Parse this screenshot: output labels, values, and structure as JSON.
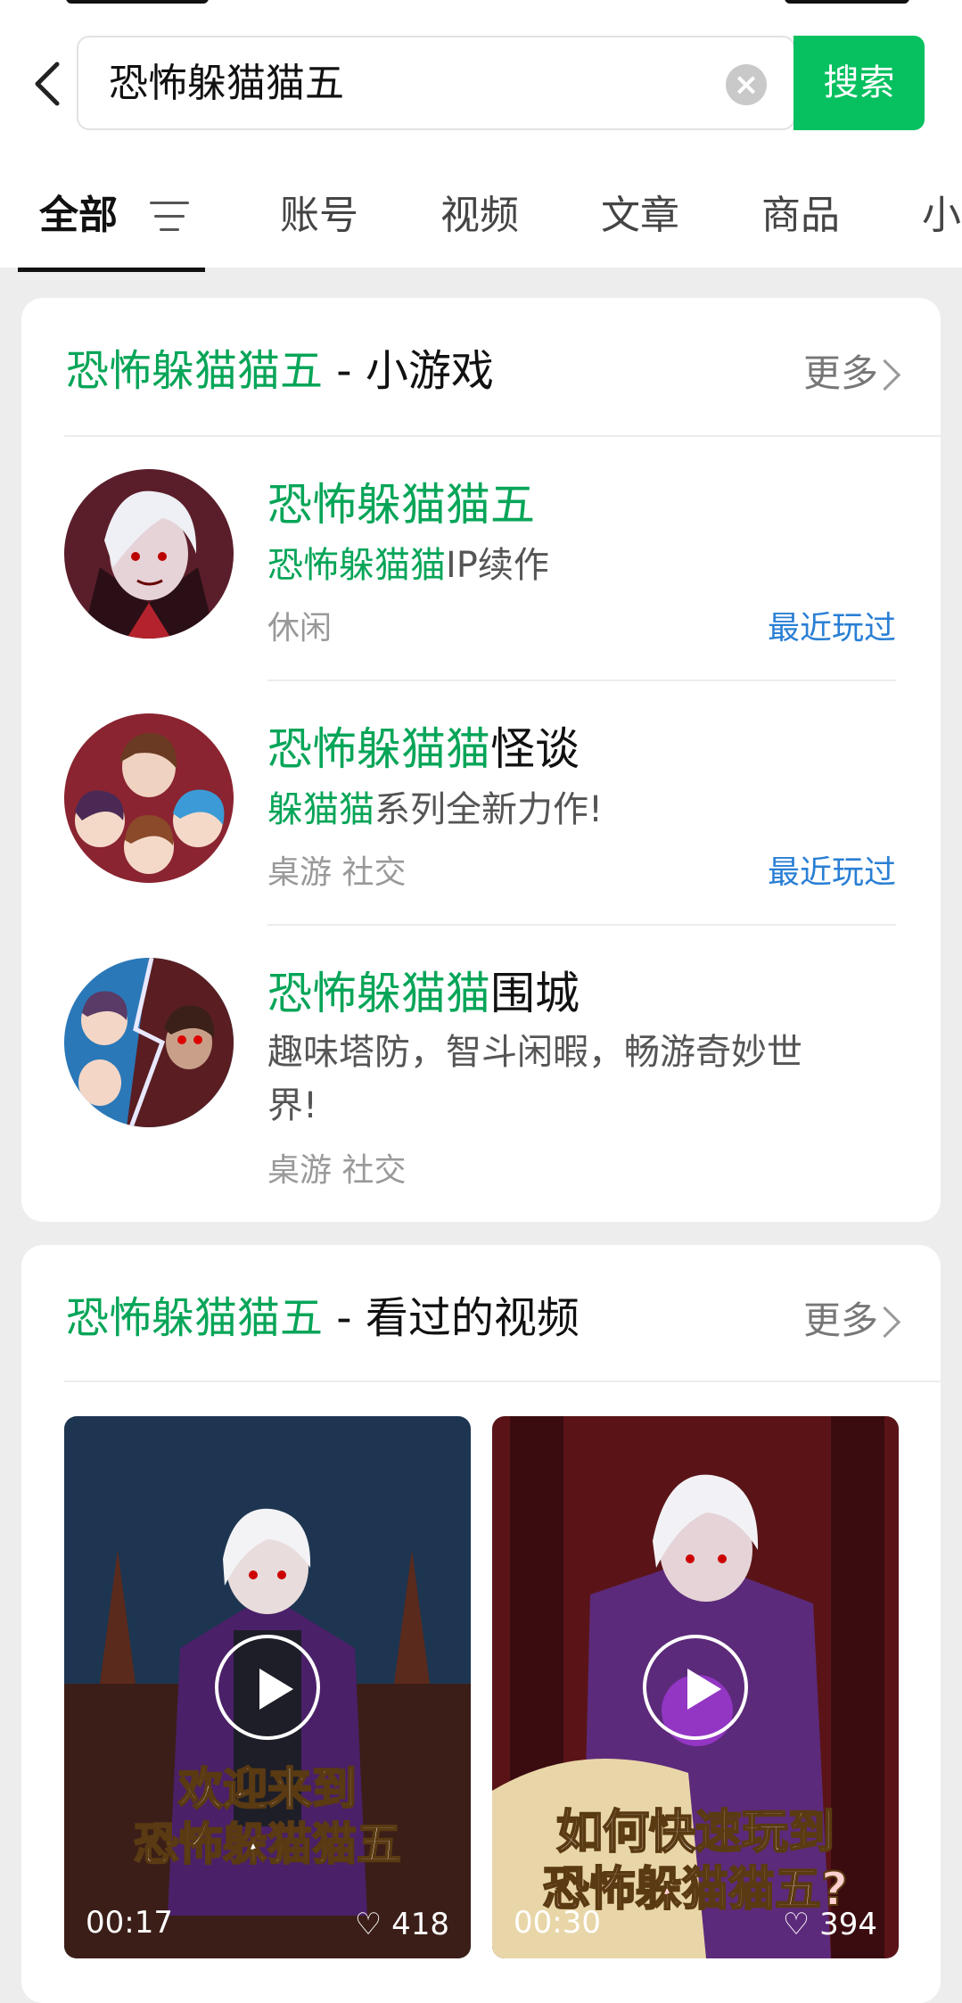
{
  "search": {
    "query": "恐怖躲猫猫五",
    "button_label": "搜索"
  },
  "tabs": [
    {
      "label": "全部"
    },
    {
      "label": "账号"
    },
    {
      "label": "视频"
    },
    {
      "label": "文章"
    },
    {
      "label": "商品"
    },
    {
      "label": "小"
    }
  ],
  "minigames": {
    "title_highlight": "恐怖躲猫猫五",
    "title_suffix": " - 小游戏",
    "more_label": "更多",
    "items": [
      {
        "name_hl": "恐怖躲猫猫五",
        "name_rest": "",
        "desc_hl": "恐怖躲猫猫",
        "desc_rest": "IP续作",
        "tags": "休闲",
        "recent": "最近玩过"
      },
      {
        "name_hl": "恐怖躲猫猫",
        "name_rest": "怪谈",
        "desc_hl": "躲猫猫",
        "desc_rest": "系列全新力作!",
        "tags": "桌游 社交",
        "recent": "最近玩过"
      },
      {
        "name_hl": "恐怖躲猫猫",
        "name_rest": "围城",
        "desc_hl": "",
        "desc_rest": "趣味塔防，智斗闲暇，畅游奇妙世界!",
        "tags": "桌游 社交",
        "recent": ""
      }
    ]
  },
  "videos": {
    "title_highlight": "恐怖躲猫猫五",
    "title_suffix": " - 看过的视频",
    "more_label": "更多",
    "items": [
      {
        "caption_line1": "欢迎来到",
        "caption_line2": "恐怖躲猫猫五",
        "duration": "00:17",
        "likes": "418"
      },
      {
        "caption_line1": "如何快速玩到",
        "caption_line2": "恐怖躲猫猫五?",
        "duration": "00:30",
        "likes": "394"
      }
    ]
  },
  "colors": {
    "accent": "#07c160",
    "highlight": "#07a558",
    "link": "#2a7fd4"
  }
}
